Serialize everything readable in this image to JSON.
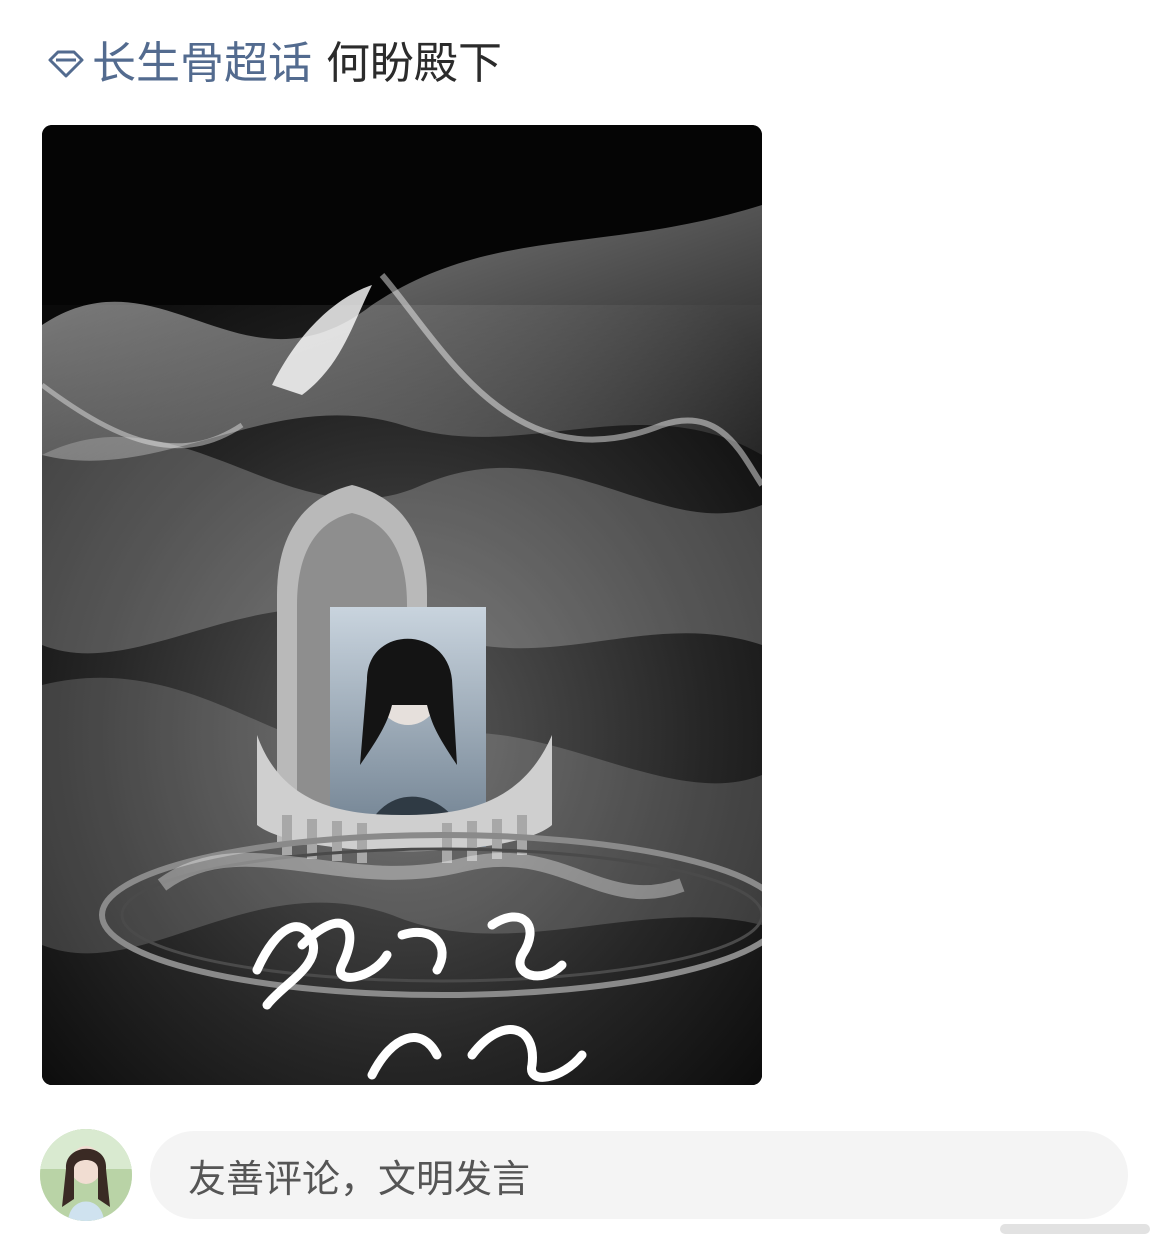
{
  "post": {
    "topic_icon": "diamond-icon",
    "topic_name": "长生骨超话",
    "text": "何盼殿下"
  },
  "image": {
    "description_icon": "poster-image",
    "accent": "#ffffff"
  },
  "comment": {
    "placeholder": "友善评论，文明发言",
    "avatar_icon": "user-avatar"
  },
  "colors": {
    "topic": "#536b8f",
    "text": "#2b2b2b",
    "input_bg": "#f4f4f4"
  }
}
